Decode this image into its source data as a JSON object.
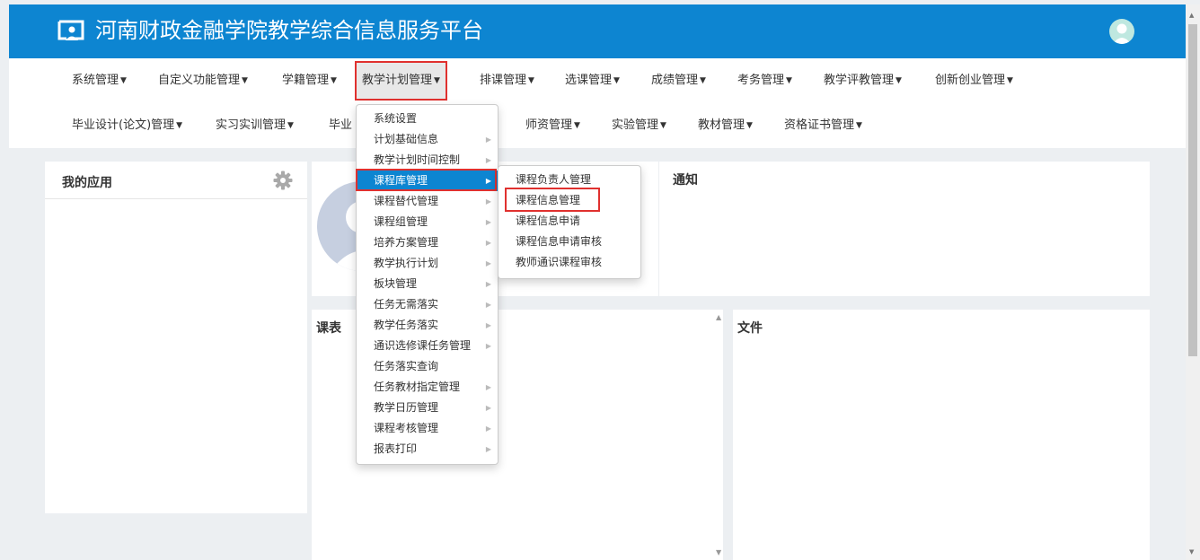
{
  "header": {
    "title": "河南财政金融学院教学综合信息服务平台",
    "brand_color": "#0d85d1"
  },
  "nav": {
    "row1": [
      "系统管理",
      "自定义功能管理",
      "学籍管理",
      "教学计划管理",
      "排课管理",
      "选课管理",
      "成绩管理",
      "考务管理",
      "教学评教管理",
      "创新创业管理"
    ],
    "row2": [
      "毕业设计(论文)管理",
      "实习实训管理",
      "毕业",
      "师资管理",
      "实验管理",
      "教材管理",
      "资格证书管理"
    ],
    "active": "教学计划管理"
  },
  "panels": {
    "my_apps": "我的应用",
    "notice": "通知",
    "schedule": "课表",
    "files": "文件"
  },
  "menu": {
    "items": [
      "系统设置",
      "计划基础信息",
      "教学计划时间控制",
      "课程库管理",
      "课程替代管理",
      "课程组管理",
      "培养方案管理",
      "教学执行计划",
      "板块管理",
      "任务无需落实",
      "教学任务落实",
      "通识选修课任务管理",
      "任务落实查询",
      "任务教材指定管理",
      "教学日历管理",
      "课程考核管理",
      "报表打印"
    ],
    "has_submenu": [
      false,
      true,
      true,
      true,
      true,
      true,
      true,
      true,
      true,
      true,
      true,
      true,
      false,
      true,
      true,
      true,
      true
    ],
    "active_index": 3
  },
  "submenu": {
    "items": [
      "课程负责人管理",
      "课程信息管理",
      "课程信息申请",
      "课程信息申请审核",
      "教师通识课程审核"
    ],
    "highlighted_index": 1
  },
  "colors": {
    "highlight_box": "#e0312f",
    "menu_hover": "#0d85d1"
  }
}
